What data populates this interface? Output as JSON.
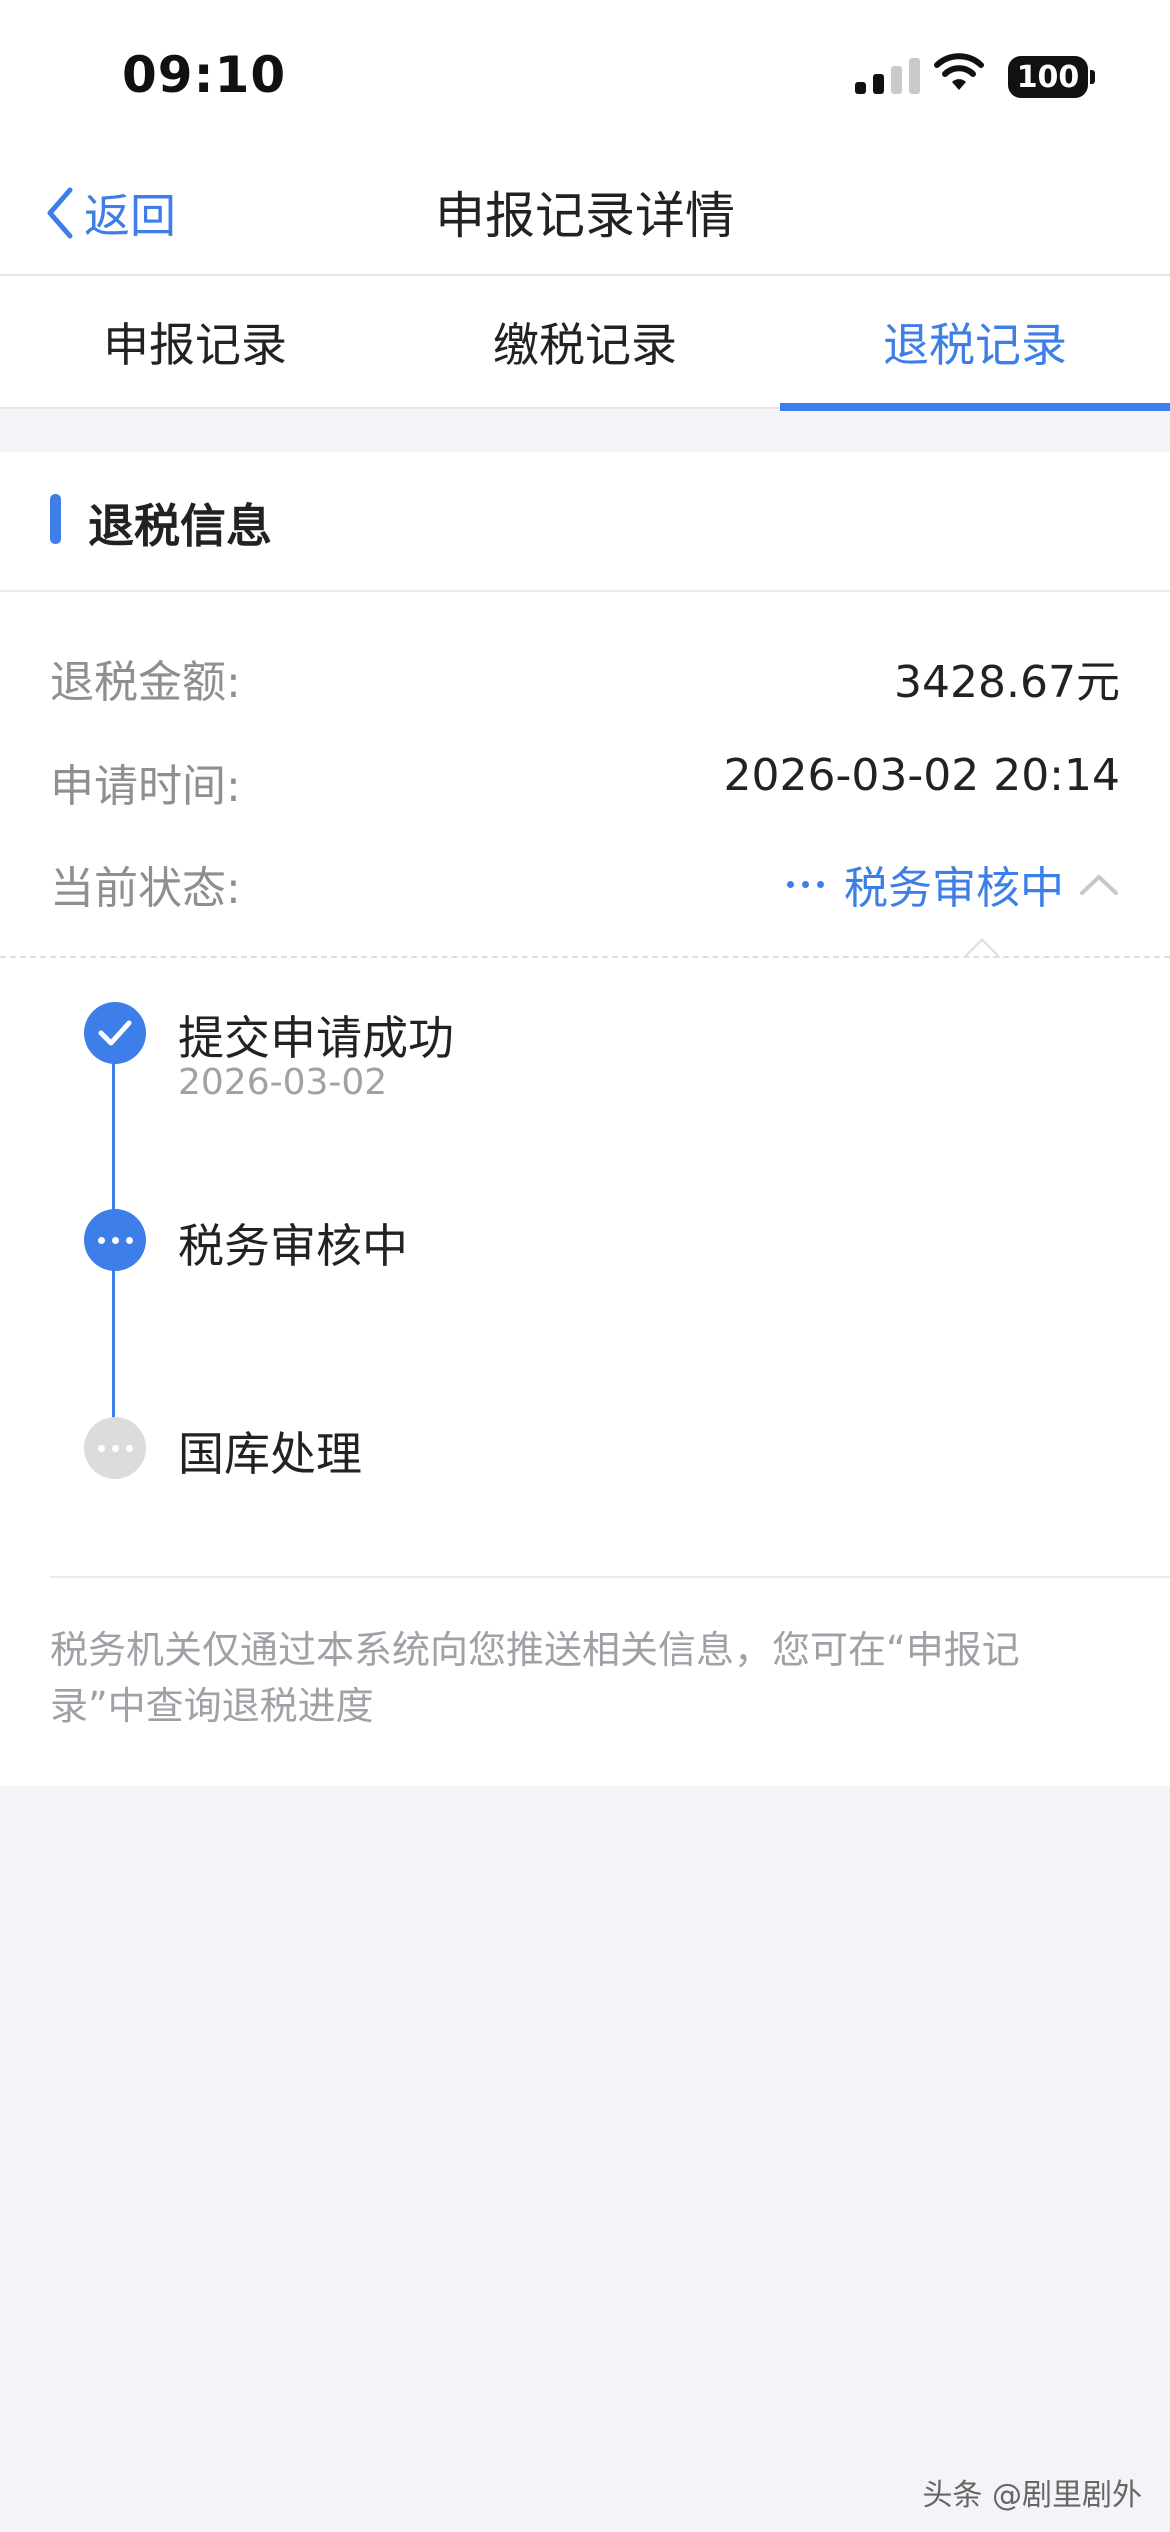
{
  "status_bar": {
    "time": "09:10",
    "battery": "100"
  },
  "nav": {
    "back_label": "返回",
    "title": "申报记录详情"
  },
  "tabs": [
    {
      "label": "申报记录",
      "active": false
    },
    {
      "label": "缴税记录",
      "active": false
    },
    {
      "label": "退税记录",
      "active": true
    }
  ],
  "refund": {
    "section_title": "退税信息",
    "amount_label": "退税金额:",
    "amount_value": "3428.67元",
    "time_label": "申请时间:",
    "time_value": "2026-03-02 20:14",
    "status_label": "当前状态:",
    "status_value": "税务审核中"
  },
  "timeline": [
    {
      "title": "提交申请成功",
      "date": "2026-03-02",
      "state": "done"
    },
    {
      "title": "税务审核中",
      "date": "",
      "state": "current"
    },
    {
      "title": "国库处理",
      "date": "",
      "state": "pending"
    }
  ],
  "notice": "税务机关仅通过本系统向您推送相关信息，您可在“申报记录”中查询退税进度",
  "watermark": "头条 @剧里剧外",
  "colors": {
    "accent": "#3d7ee8",
    "background": "#f3f4f8",
    "muted_text": "#8e8e93",
    "pending_dot": "#dcdcdf"
  }
}
